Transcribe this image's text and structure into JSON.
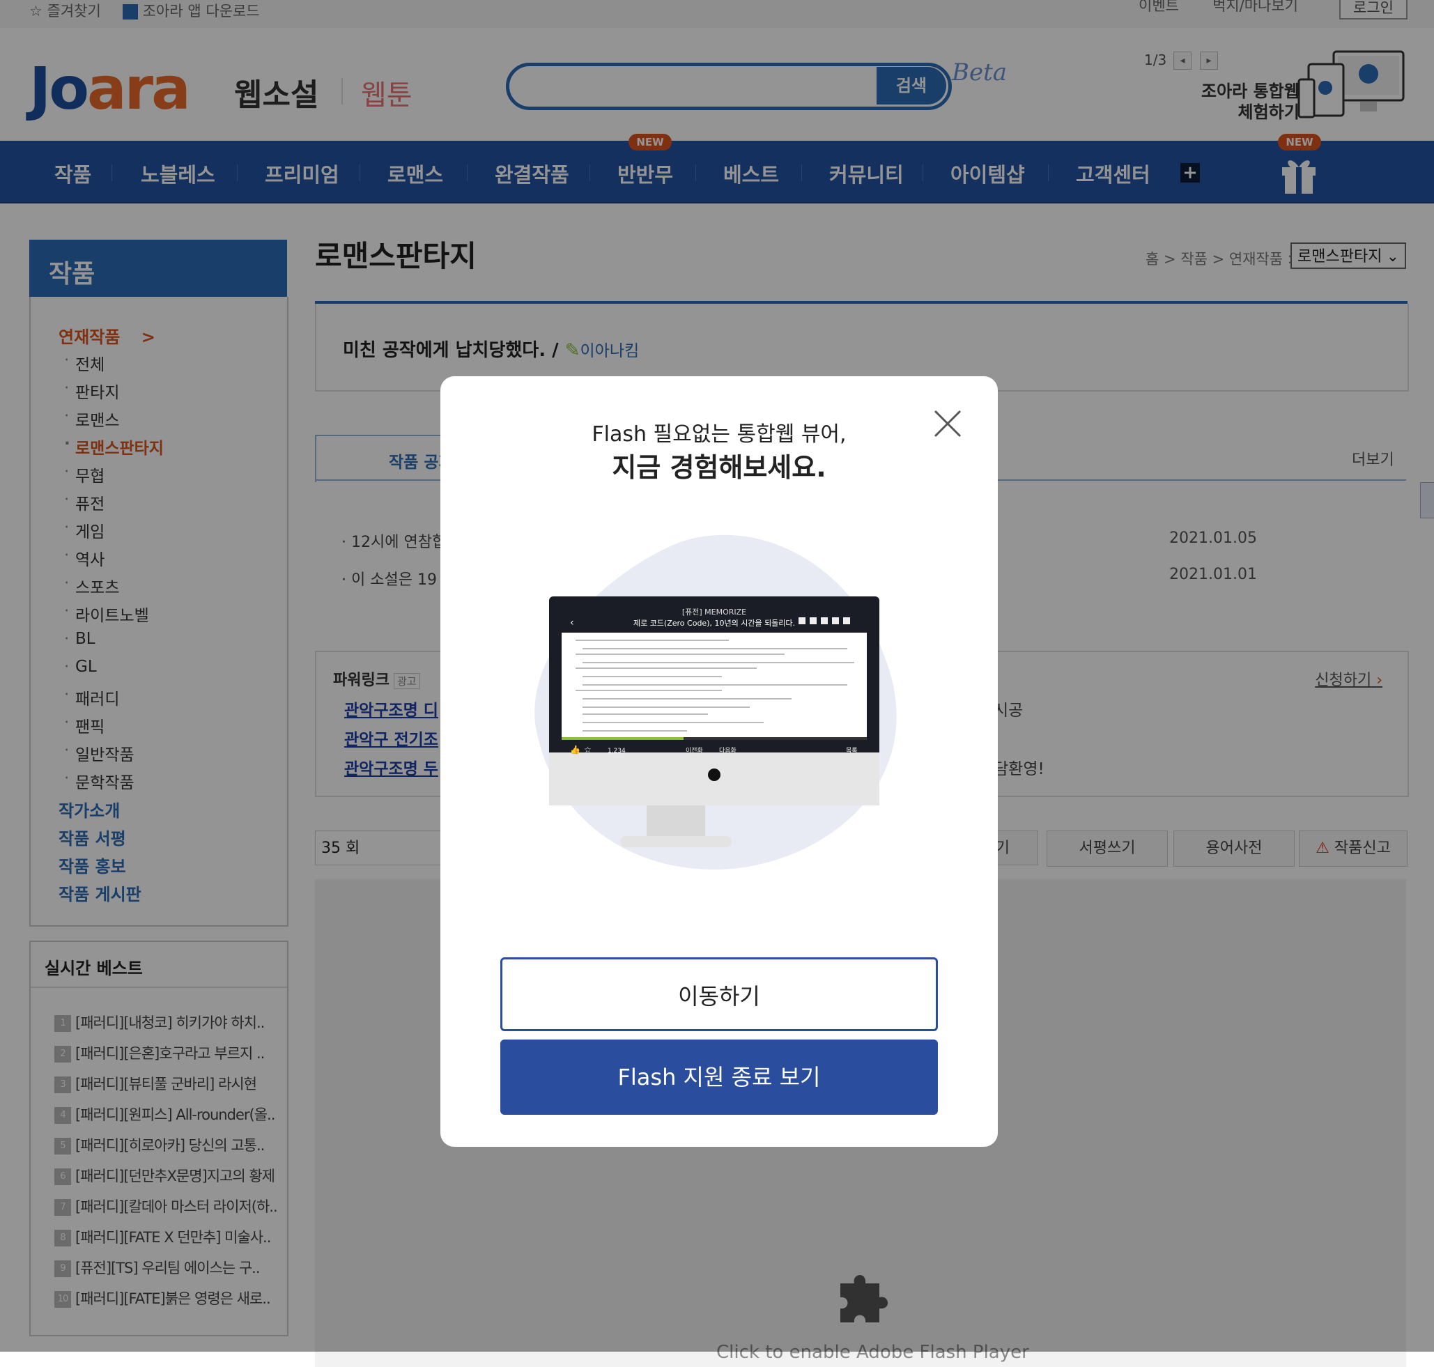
{
  "topbar": {
    "favorites": "즐겨찾기",
    "app_download": "조아라 앱 다운로드",
    "event": "이벤트",
    "mypage": "벅지/마나보기",
    "login": "로그인"
  },
  "header": {
    "logo_main": "Jo",
    "logo_accent": "ara",
    "web_novel": "웹소설",
    "webtoon": "웹툰",
    "search_button": "검색",
    "search_placeholder": "",
    "beta": "Beta",
    "promo_page": "1/3",
    "promo_line1": "조아라 통합웹",
    "promo_line2": "체험하기"
  },
  "nav": {
    "items": [
      "작품",
      "노블레스",
      "프리미엄",
      "로맨스",
      "완결작품",
      "반반무",
      "베스트",
      "커뮤니티",
      "아이템샵",
      "고객센터"
    ],
    "new_badge": "NEW",
    "plus": "+"
  },
  "sidebar": {
    "header": "작품",
    "serial": "연재작품",
    "serial_arrow": ">",
    "items": [
      "전체",
      "판타지",
      "로맨스",
      "로맨스판타지",
      "무협",
      "퓨전",
      "게임",
      "역사",
      "스포츠",
      "라이트노벨",
      "BL",
      "GL",
      "패러디",
      "팬픽",
      "일반작품",
      "문학작품"
    ],
    "links": [
      "작가소개",
      "작품 서평",
      "작품 홍보",
      "작품 게시판"
    ]
  },
  "best": {
    "title": "실시간 베스트",
    "rows": [
      {
        "num": "1",
        "text": "[패러디][내청코] 히키가야 하치.."
      },
      {
        "num": "2",
        "text": "[패러디][은혼]호구라고 부르지 .."
      },
      {
        "num": "3",
        "text": "[패러디][뷰티풀 군바리] 라시현"
      },
      {
        "num": "4",
        "text": "[패러디][원피스] All-rounder(올.."
      },
      {
        "num": "5",
        "text": "[패러디][히로아카] 당신의 고통.."
      },
      {
        "num": "6",
        "text": "[패러디][던만추X문명]지고의 황제"
      },
      {
        "num": "7",
        "text": "[패러디][칼데아 마스터 라이저(하.."
      },
      {
        "num": "8",
        "text": "[패러디][FATE X 던만추] 미술사.."
      },
      {
        "num": "9",
        "text": "[퓨전][TS] 우리팀 에이스는 구.."
      },
      {
        "num": "10",
        "text": "[패러디][FATE]붉은 영령은 새로.."
      }
    ]
  },
  "main": {
    "title": "로맨스판타지",
    "breadcrumb": "홈 > 작품 > 연재작품 >",
    "genre_select": "로맨스판타지",
    "novel_title": "미친 공작에게 납치당했다. /",
    "novel_author": "이아나킴",
    "notice_tab": "작품 공지",
    "more": "더보기",
    "notices": [
      {
        "text": "12시에 연참합",
        "date": "2021.01.05"
      },
      {
        "text": "이 소설은 19",
        "date": "2021.01.01"
      }
    ],
    "powerlink": {
      "title": "파워링크",
      "ad": "광고",
      "apply": "신청하기",
      "links": [
        "관악구조명 디",
        "관악구 전기조",
        "관악구조명 두"
      ],
      "tails": [
        "시공",
        "",
        "담환영!"
      ]
    },
    "episode_select": "35 회",
    "actions": [
      "기",
      "서평쓰기",
      "용어사전",
      "작품신고"
    ],
    "flash_text": "Click to enable Adobe Flash Player"
  },
  "modal": {
    "line1": "Flash 필요없는 통합웹 뷰어,",
    "line2": "지금 경험해보세요.",
    "move_button": "이동하기",
    "end_button": "Flash 지원 종료 보기",
    "screen_header_small": "[퓨전] MEMORIZE",
    "screen_header_title": "제로 코드(Zero Code), 10년의 시간을 되돌리다.",
    "screen_count": "1,234",
    "screen_prev": "이전화",
    "screen_next": "다음화",
    "screen_list": "목록"
  }
}
